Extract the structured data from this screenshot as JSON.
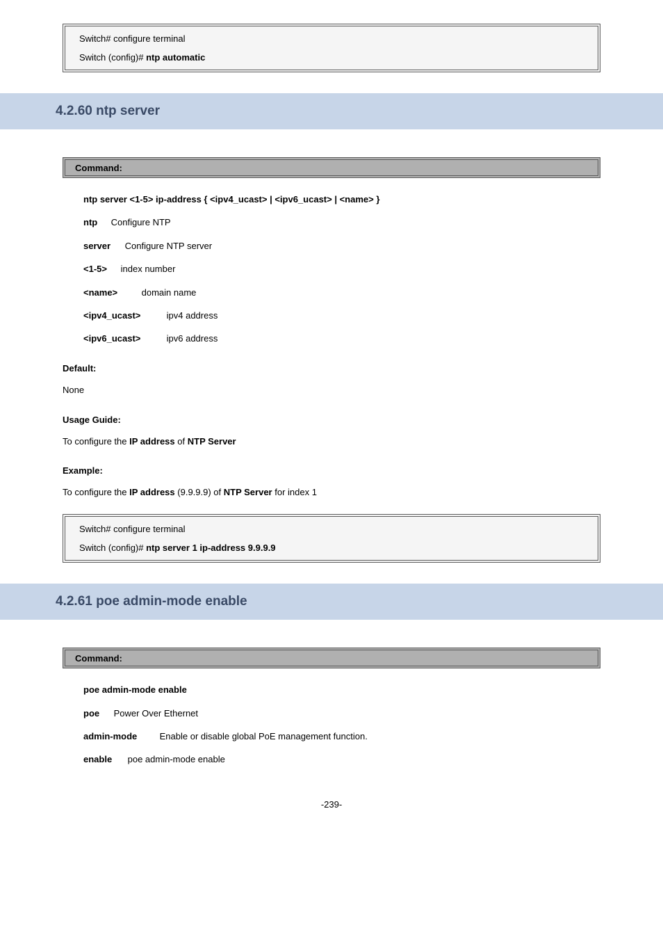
{
  "codebox1": {
    "line1": "Switch# configure terminal",
    "line2_prefix": "Switch (config)#",
    "line2_cmd": "ntp automatic"
  },
  "section1": {
    "title": "4.2.60 ntp server",
    "greybar": "Command:",
    "cmd_sig": "ntp server <1-5> ip-address { <ipv4_ucast> | <ipv6_ucast> | <name> }",
    "ntp_lbl": "ntp",
    "ntp_desc": "Configure NTP",
    "server_lbl": "server",
    "server_desc": "Configure NTP server",
    "idx_lbl": "<1-5>",
    "idx_desc": "index number",
    "name_lbl": "<name>",
    "name_desc": "domain name",
    "ipv4_lbl": "<ipv4_ucast>",
    "ipv4_desc": "ipv4 address",
    "ipv6_lbl": "<ipv6_ucast>",
    "ipv6_desc": "ipv6 address",
    "default_h": "Default:",
    "default_v": "None",
    "usage_h": "Usage Guide:",
    "usage_1": "To configure the ",
    "usage_2": "IP address",
    "usage_3": " of ",
    "usage_4": "NTP Server",
    "example_h": "Example:",
    "ex_1": "To configure the ",
    "ex_2": "IP address",
    "ex_3": " (9.9.9.9) of ",
    "ex_4": "NTP Server",
    "ex_5": " for index 1",
    "cb2_line1": "Switch# configure terminal",
    "cb2_line2_prefix": "Switch (config)#",
    "cb2_line2_cmd": "ntp server 1 ip-address 9.9.9.9"
  },
  "section2": {
    "title": "4.2.61 poe admin-mode enable",
    "greybar": "Command:",
    "cmd_sig": "poe admin-mode enable",
    "poe_lbl": "poe",
    "poe_desc": "Power Over Ethernet",
    "admin_lbl": "admin-mode",
    "admin_desc": "Enable or disable global PoE management function.",
    "enable_lbl": "enable",
    "enable_desc": "poe admin-mode enable"
  },
  "footer": "-239-"
}
